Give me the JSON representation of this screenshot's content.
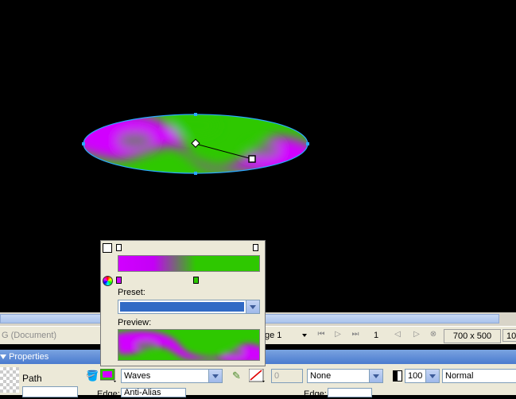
{
  "status": {
    "doc_title": "G (Document)",
    "page_label": "ge 1",
    "frame_number": "1",
    "canvas_size": "700 x 500",
    "zoom_partial": "10"
  },
  "properties": {
    "panel_title": "Properties",
    "object_type": "Path",
    "fill_texture": "Waves",
    "edge_label": "Edge:",
    "edge_value": "Anti-Alias",
    "stroke_size": "0",
    "stroke_texture": "None",
    "stroke_edge_label": "Edge:",
    "opacity": "100",
    "blend_mode": "Normal"
  },
  "gradient_editor": {
    "preset_label": "Preset:",
    "preview_label": "Preview:",
    "preset_value": ""
  },
  "colors": {
    "magenta": "#d100ff",
    "green": "#2ec800",
    "handle_blue": "#2aa9ff"
  }
}
